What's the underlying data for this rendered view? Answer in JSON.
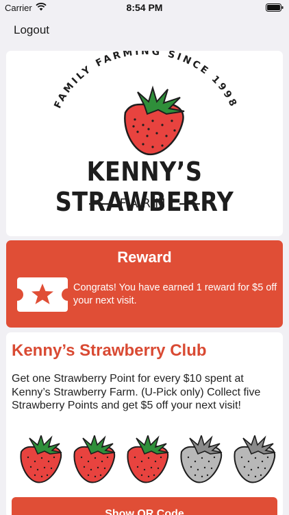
{
  "status_bar": {
    "carrier": "Carrier",
    "time": "8:54 PM"
  },
  "nav": {
    "logout_label": "Logout"
  },
  "logo": {
    "arc_text": "FAMILY FARMING SINCE 1998",
    "name": "KENNY’S STRAWBERRY",
    "subtitle": "FARM"
  },
  "reward": {
    "title": "Reward",
    "message": "Congrats! You have earned 1 reward for $5 off your next visit."
  },
  "club": {
    "title": "Kenny’s Strawberry Club",
    "description": "Get one Strawberry Point for every $10 spent at Kenny’s Strawberry Farm. (U-Pick only) Collect five Strawberry Points and get $5 off your next visit!",
    "points_earned": 3,
    "points_total": 5,
    "qr_button_label": "Show QR Code"
  },
  "colors": {
    "accent": "#e04e36",
    "earned": "#e8433f",
    "unearned": "#b8b8b8"
  }
}
